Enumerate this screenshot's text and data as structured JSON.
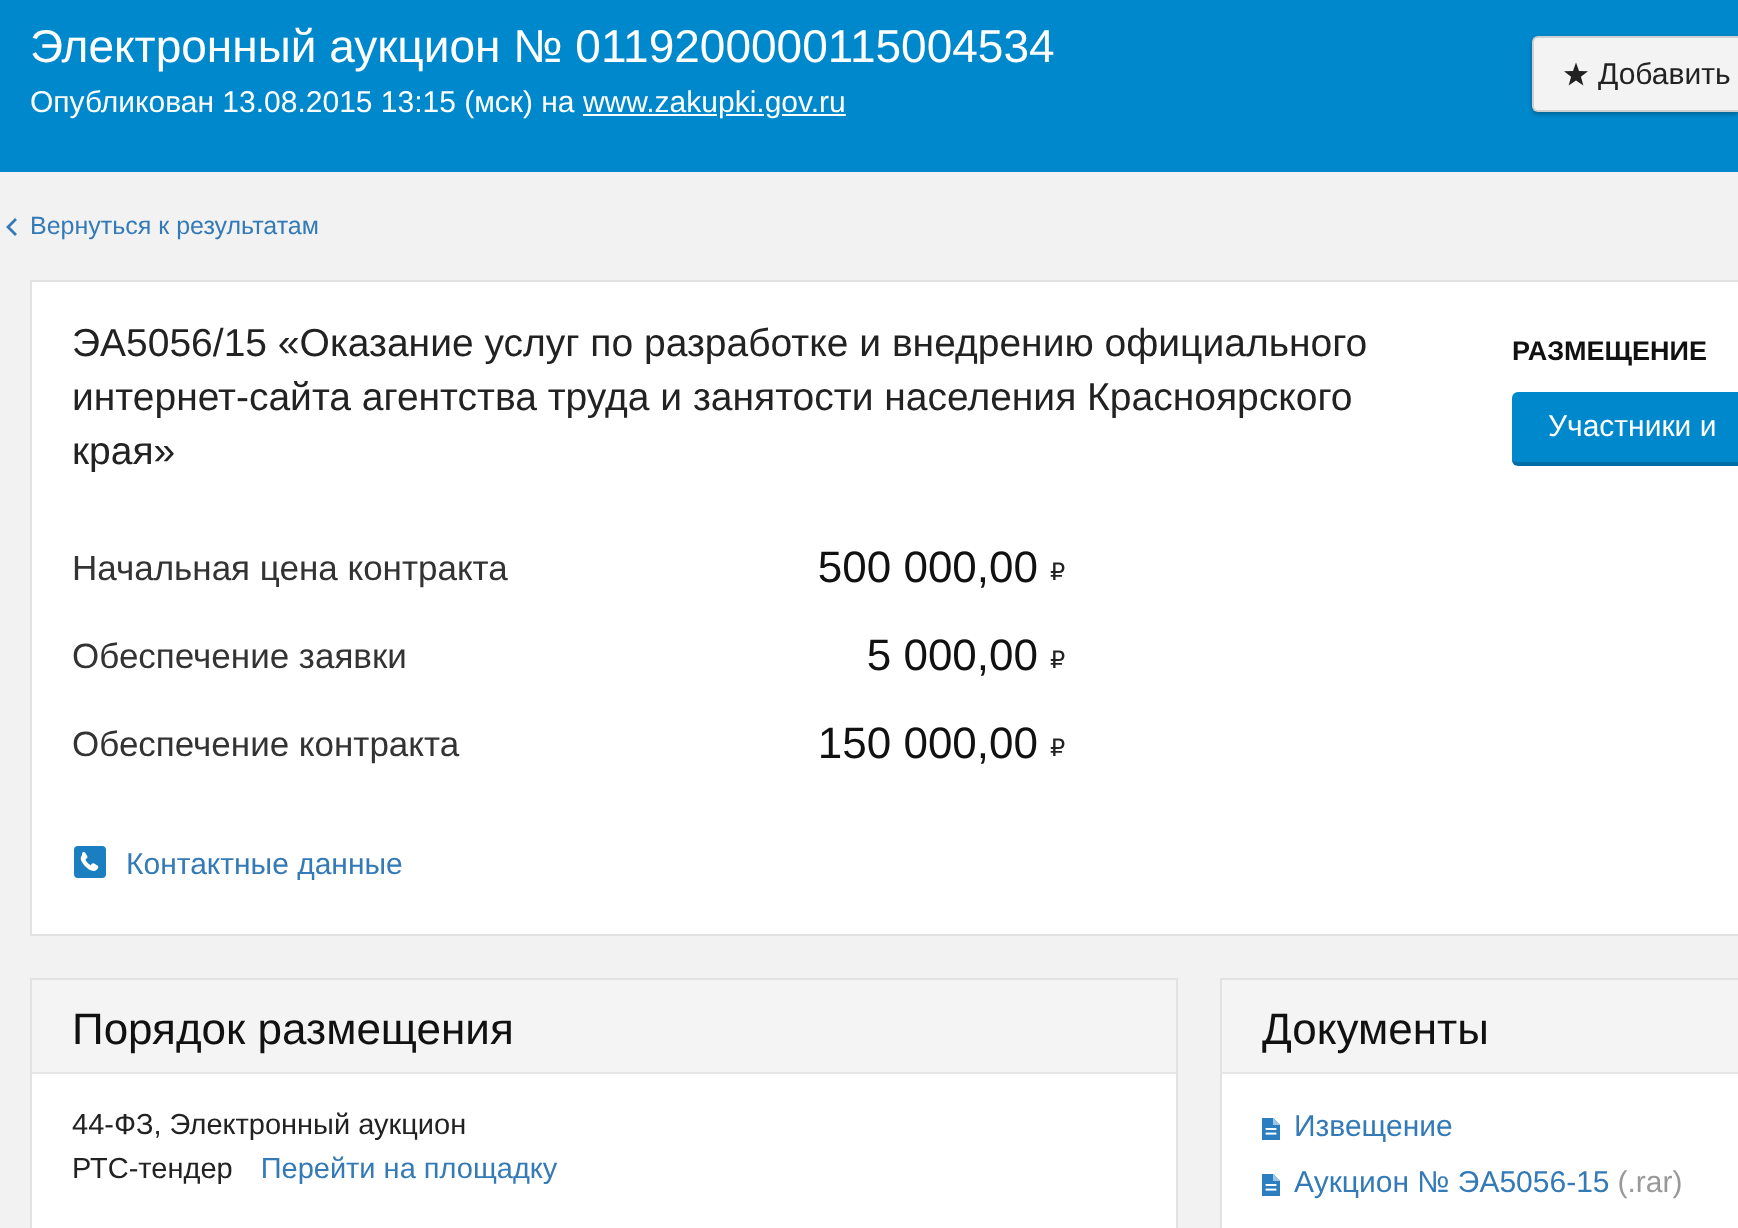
{
  "header": {
    "title": "Электронный аукцион № 0119200000115004534",
    "publication": {
      "text": "Опубликован 13.08.2015 13:15 (мск) на",
      "link": "www.zakupki.gov.ru"
    },
    "favorite_button": {
      "label": "Добавить"
    }
  },
  "back_link": {
    "label": "Вернуться к результатам"
  },
  "summary": {
    "title": "ЭА5056/15 «Оказание услуг по разработке и внедрению официального интернет-сайта агентства труда и занятости населения Красноярского края»",
    "prices": [
      {
        "label": "Начальная цена контракта",
        "value": "500 000,00",
        "currency": "₽"
      },
      {
        "label": "Обеспечение заявки",
        "value": "5 000,00",
        "currency": "₽"
      },
      {
        "label": "Обеспечение контракта",
        "value": "150 000,00",
        "currency": "₽"
      }
    ],
    "contacts_link": "Контактные данные",
    "placement": {
      "heading": "РАЗМЕЩЕНИЕ",
      "button": "Участники и"
    }
  },
  "procedure": {
    "heading": "Порядок размещения",
    "law": "44-ФЗ, Электронный аукцион",
    "platform": "РТС-тендер",
    "platform_link": "Перейти на площадку"
  },
  "documents": {
    "heading": "Документы",
    "items": [
      {
        "label": "Извещение"
      },
      {
        "label": "Аукцион № ЭА5056-15",
        "extension": "(.rar)"
      }
    ]
  }
}
